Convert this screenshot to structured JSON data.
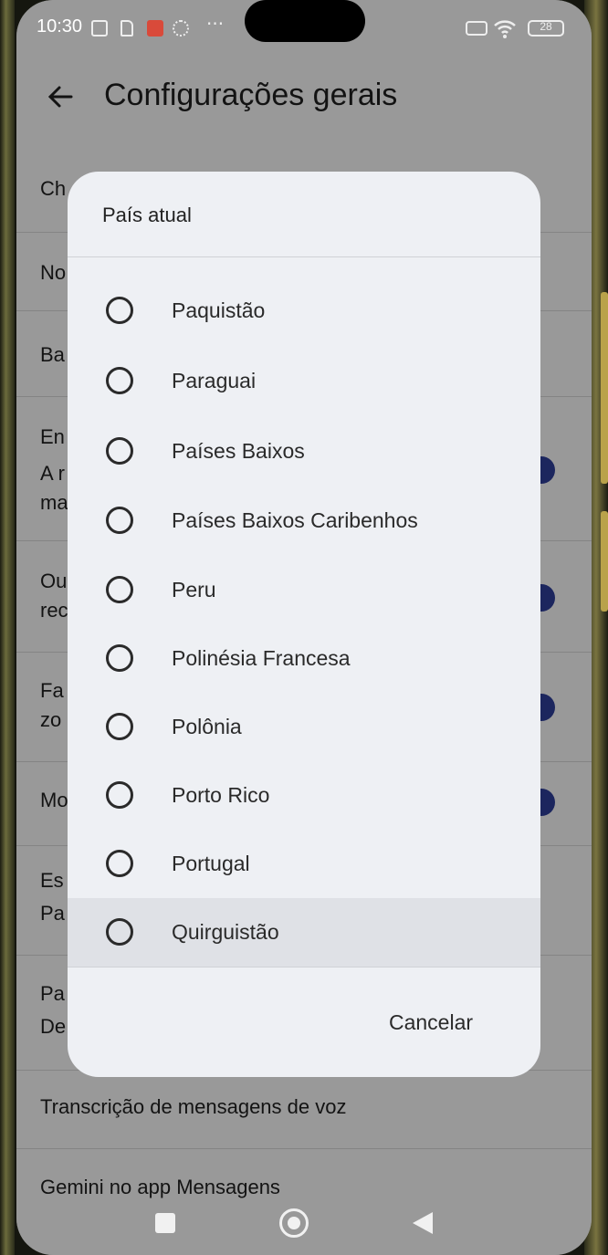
{
  "status_bar": {
    "time": "10:30",
    "more": "···",
    "battery": "28"
  },
  "header": {
    "title": "Configurações gerais"
  },
  "background_rows": [
    {
      "line1": "Ch",
      "line2": "",
      "line3": ""
    },
    {
      "line1": "No",
      "line2": "",
      "line3": ""
    },
    {
      "line1": "Ba",
      "line2": "",
      "line3": ""
    },
    {
      "line1": "En",
      "line2": "A r",
      "line3": "ma"
    },
    {
      "line1": "Ou",
      "line2": "rec",
      "line3": ""
    },
    {
      "line1": "Fa",
      "line2": "zo",
      "line3": ""
    },
    {
      "line1": "Mo",
      "line2": "",
      "line3": ""
    },
    {
      "line1": "Es",
      "line2": "Pa",
      "line3": ""
    },
    {
      "line1": "Pa",
      "line2": "De",
      "line3": ""
    },
    {
      "line1": "Transcrição de mensagens de voz",
      "line2": "",
      "line3": ""
    },
    {
      "line1": "Gemini no app Mensagens",
      "line2": "",
      "line3": ""
    }
  ],
  "dialog": {
    "title": "País atual",
    "options": [
      {
        "label": "Paquistão",
        "selected": false
      },
      {
        "label": "Paraguai",
        "selected": false
      },
      {
        "label": "Países Baixos",
        "selected": false
      },
      {
        "label": "Países Baixos Caribenhos",
        "selected": false
      },
      {
        "label": "Peru",
        "selected": false
      },
      {
        "label": "Polinésia Francesa",
        "selected": false
      },
      {
        "label": "Polônia",
        "selected": false
      },
      {
        "label": "Porto Rico",
        "selected": false
      },
      {
        "label": "Portugal",
        "selected": false
      },
      {
        "label": "Quirguistão",
        "selected": false
      }
    ],
    "cancel_label": "Cancelar"
  },
  "colors": {
    "toggle_on": "#2b3a8f",
    "dialog_bg": "#eef0f4",
    "highlight": "#dfe1e6"
  }
}
